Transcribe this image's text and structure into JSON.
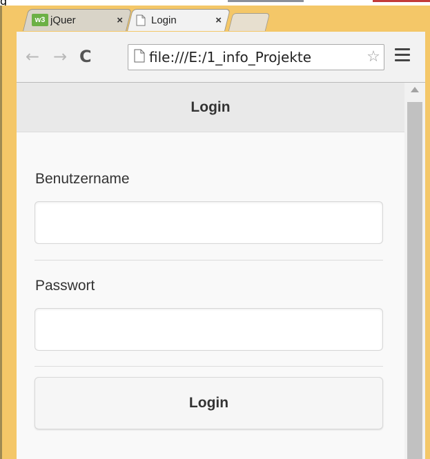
{
  "browser": {
    "partial_top_text": "g",
    "tabs": [
      {
        "label": "jQuer",
        "icon": "w3schools-icon",
        "icon_text": "w3",
        "close": "×"
      },
      {
        "label": "Login",
        "icon": "page-icon",
        "close": "×"
      }
    ],
    "nav": {
      "back": "←",
      "forward": "→",
      "reload": "C"
    },
    "url": "file:///E:/1_info_Projekte",
    "star": "☆"
  },
  "page": {
    "header_title": "Login",
    "username_label": "Benutzername",
    "username_value": "",
    "password_label": "Passwort",
    "password_value": "",
    "login_button": "Login"
  },
  "colors": {
    "frame": "#f4c768",
    "header_bar": "#e9e9e9",
    "page_bg": "#f9f9f9",
    "w3_icon": "#6cb046"
  }
}
